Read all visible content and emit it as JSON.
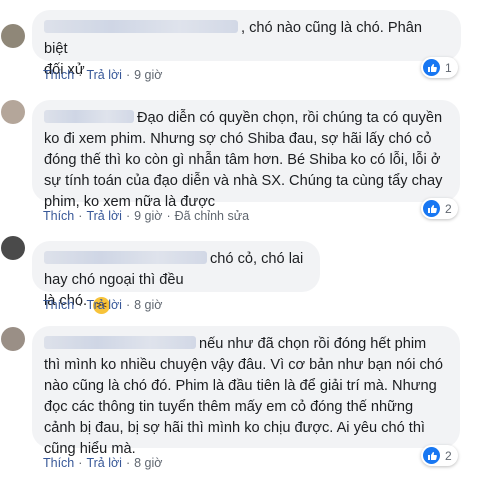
{
  "comments": [
    {
      "lines_first": ", chó nào cũng là chó. Phân biệt",
      "lines_rest": [
        "đối xử"
      ],
      "actions": {
        "like": "Thích",
        "reply": "Trả lời",
        "time": "9 giờ",
        "edited": ""
      },
      "reactions": "1",
      "avatar_color": "#8f8778"
    },
    {
      "lines_first": "Đạo diễn có quyền chọn, rồi chúng ta có quyền",
      "lines_rest": [
        "ko đi xem phim. Nhưng sợ chó Shiba đau, sợ hãi lấy chó cỏ",
        "đóng thế thì ko còn gì nhẫn tâm hơn. Bé Shiba ko có lỗi, lỗi ở",
        "sự tính toán của đạo diễn và nhà SX. Chúng ta cùng tẩy chay",
        "phim, ko xem nữa là được"
      ],
      "actions": {
        "like": "Thích",
        "reply": "Trả lời",
        "time": "9 giờ",
        "edited": "Đã chỉnh sửa"
      },
      "reactions": "2",
      "avatar_color": "#b4a69a"
    },
    {
      "lines_first": "chó cỏ, chó lai hay chó ngoại thì đều",
      "lines_rest": [
        "là chó."
      ],
      "actions": {
        "like": "Thích",
        "reply": "Trả lời",
        "time": "8 giờ",
        "edited": ""
      },
      "reactions": "",
      "avatar_color": "#4a4a4a"
    },
    {
      "lines_first": "nếu như đã chọn rồi đóng hết phim",
      "lines_rest": [
        "thì mình ko nhiều chuyện vậy đâu. Vì cơ bản như bạn nói chó",
        "nào cũng là chó đó. Phim là đầu tiên là để giải trí mà. Nhưng",
        "đọc các thông tin tuyển thêm mấy em cỏ đóng thế những",
        "cảnh bị đau, bị sợ hãi thì mình ko chịu được. Ai yêu chó thì",
        "cũng hiểu mà."
      ],
      "actions": {
        "like": "Thích",
        "reply": "Trả lời",
        "time": "8 giờ",
        "edited": ""
      },
      "reactions": "2",
      "avatar_color": "#9a8f86"
    }
  ],
  "colors": {
    "bubble": "#f2f3f5",
    "link": "#385898",
    "meta": "#606770",
    "like": "#1877f2"
  },
  "icons": {
    "like": "like-thumb-icon",
    "laugh": "laughing-emoji-icon"
  }
}
